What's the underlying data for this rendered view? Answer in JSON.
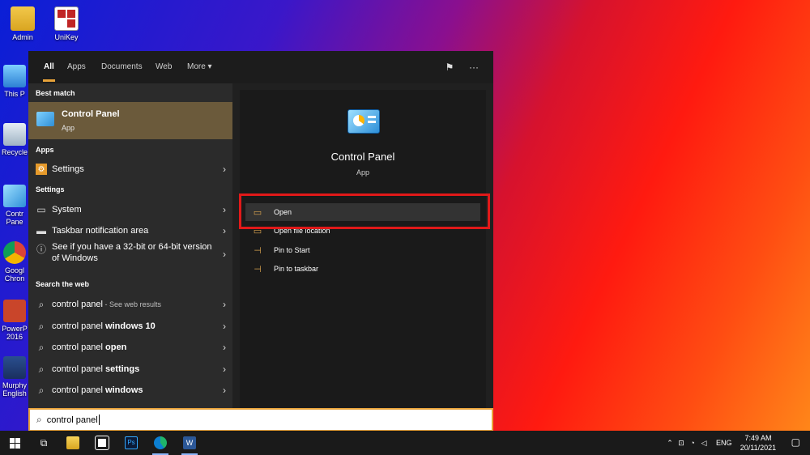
{
  "desktop": {
    "icons": [
      {
        "label": "Admin",
        "icon": "user-folder-icon"
      },
      {
        "label": "UniKey",
        "icon": "unikey-icon"
      }
    ],
    "partial_icons": [
      {
        "label": "This P",
        "icon": "this-pc-icon"
      },
      {
        "label": "Recycle",
        "icon": "recycle-bin-icon"
      },
      {
        "label": "Contr\nPane",
        "icon": "control-panel-icon"
      },
      {
        "label": "Googl\nChron",
        "icon": "chrome-icon"
      },
      {
        "label": "PowerP\n2016",
        "icon": "powerpoint-icon"
      },
      {
        "label": "Murphy\nEnglish",
        "icon": "book-icon"
      }
    ]
  },
  "start_menu": {
    "tabs": [
      "All",
      "Apps",
      "Documents",
      "Web",
      "More ▾"
    ],
    "active_tab": "All",
    "best_match_header": "Best match",
    "best_match": {
      "title": "Control Panel",
      "subtitle": "App"
    },
    "apps_header": "Apps",
    "apps": [
      {
        "label": "Settings",
        "icon": "settings-icon"
      }
    ],
    "settings_header": "Settings",
    "settings": [
      {
        "label": "System",
        "icon": "monitor-icon"
      },
      {
        "label": "Taskbar notification area",
        "icon": "taskbar-icon"
      },
      {
        "label": "See if you have a 32-bit or 64-bit version of Windows",
        "icon": "info-icon"
      }
    ],
    "web_header": "Search the web",
    "web": [
      {
        "label": "control panel",
        "suffix": " - See web results"
      },
      {
        "label": "control panel",
        "bold": " windows 10"
      },
      {
        "label": "control panel",
        "bold": " open"
      },
      {
        "label": "control panel",
        "bold": " settings"
      },
      {
        "label": "control panel",
        "bold": " windows"
      }
    ],
    "detail": {
      "title": "Control Panel",
      "subtitle": "App",
      "actions": [
        {
          "label": "Open",
          "icon": "open-icon"
        },
        {
          "label": "Open file location",
          "icon": "folder-icon"
        },
        {
          "label": "Pin to Start",
          "icon": "pin-icon"
        },
        {
          "label": "Pin to taskbar",
          "icon": "pin-icon"
        }
      ]
    },
    "search_value": "control panel"
  },
  "taskbar": {
    "apps": [
      "start-icon",
      "task-view-icon",
      "file-explorer-icon",
      "store-icon",
      "photoshop-icon",
      "edge-icon",
      "word-icon"
    ],
    "lang": "ENG",
    "time": "7:49 AM",
    "date": "20/11/2021"
  },
  "colors": {
    "accent": "#e9a33a",
    "best_match_bg": "#6b5a3b",
    "highlight_box": "#e11919"
  }
}
